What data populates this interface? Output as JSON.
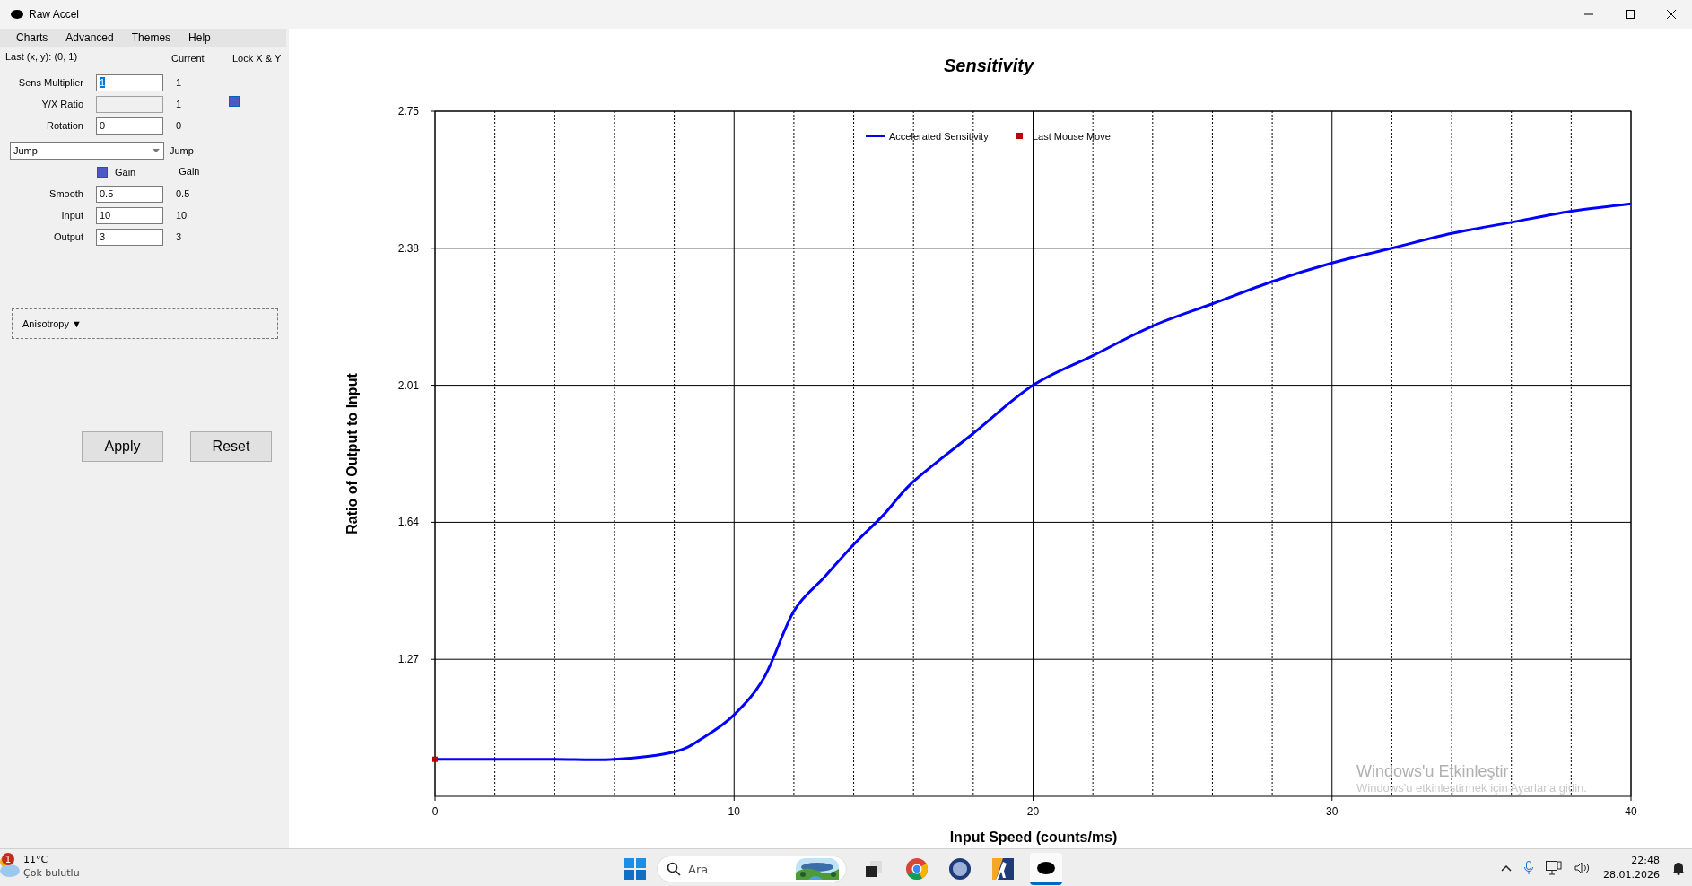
{
  "window": {
    "title": "Raw Accel"
  },
  "menu": [
    "Charts",
    "Advanced",
    "Themes",
    "Help"
  ],
  "panel": {
    "last_position": "Last (x, y): (0, 1)",
    "current_header": "Current",
    "lock_header": "Lock X & Y",
    "lock_checkbox": {
      "checked": true
    },
    "fields": [
      {
        "label": "Sens Multiplier",
        "value": "1",
        "current": "1",
        "disabled": false,
        "text_selected": true
      },
      {
        "label": "Y/X Ratio",
        "current": "1",
        "disabled": true
      },
      {
        "label": "Rotation",
        "value": "0",
        "current": "0",
        "disabled": false,
        "text_selected": false
      }
    ],
    "mode_dropdown": {
      "value": "Jump",
      "current": "Jump"
    },
    "gain_checkbox": {
      "label": "Gain",
      "checked": true,
      "current": "Gain"
    },
    "params": [
      {
        "label": "Smooth",
        "value": "0.5",
        "current": "0.5"
      },
      {
        "label": "Input",
        "value": "10",
        "current": "10"
      },
      {
        "label": "Output",
        "value": "3",
        "current": "3"
      }
    ],
    "anisotropy": {
      "label": "Anisotropy ▼",
      "expanded": false
    },
    "buttons": [
      "Apply",
      "Reset"
    ]
  },
  "chart": {
    "chart_data": {
      "type": "line",
      "title": "Sensitivity",
      "xlabel": "Input Speed (counts/ms)",
      "ylabel": "Ratio of Output to Input",
      "x": [
        0,
        2,
        4,
        6,
        8,
        9,
        10,
        11,
        12,
        13,
        14,
        15,
        16,
        18,
        20,
        22,
        24,
        26,
        28,
        30,
        32,
        34,
        36,
        38,
        40
      ],
      "series": [
        {
          "name": "Accelerated Sensitivity",
          "color": "#0000ff",
          "values": [
            1.0,
            1.0,
            1.0,
            1.0,
            1.02,
            1.06,
            1.12,
            1.22,
            1.4,
            1.49,
            1.58,
            1.66,
            1.75,
            1.88,
            2.01,
            2.09,
            2.17,
            2.23,
            2.29,
            2.34,
            2.38,
            2.42,
            2.45,
            2.48,
            2.5
          ]
        },
        {
          "name": "Last Mouse Move",
          "color": "#c00000",
          "marker": "square",
          "values": [
            1.0,
            null,
            null,
            null,
            null,
            null,
            null,
            null,
            null,
            null,
            null,
            null,
            null,
            null,
            null,
            null,
            null,
            null,
            null,
            null,
            null,
            null,
            null,
            null,
            null
          ]
        }
      ],
      "grid": true,
      "legend": "upper center",
      "xlim": [
        0,
        40
      ],
      "ylim": [
        0.9,
        2.75
      ],
      "xticks": [
        0,
        10,
        20,
        30,
        40
      ],
      "yticks": [
        1.27,
        1.64,
        2.01,
        2.38,
        2.75
      ]
    },
    "activation_notice": {
      "title": "Windows'u Etkinleştir",
      "text": "Windows'u etkinleştirmek için Ayarlar'a gidin."
    }
  },
  "taskbar": {
    "weather": {
      "badge": "1",
      "temperature": "11°C",
      "condition": "Çok bulutlu"
    },
    "search": {
      "placeholder": "Ara"
    },
    "clock": {
      "time": "22:48",
      "date": "28.01.2026"
    }
  }
}
